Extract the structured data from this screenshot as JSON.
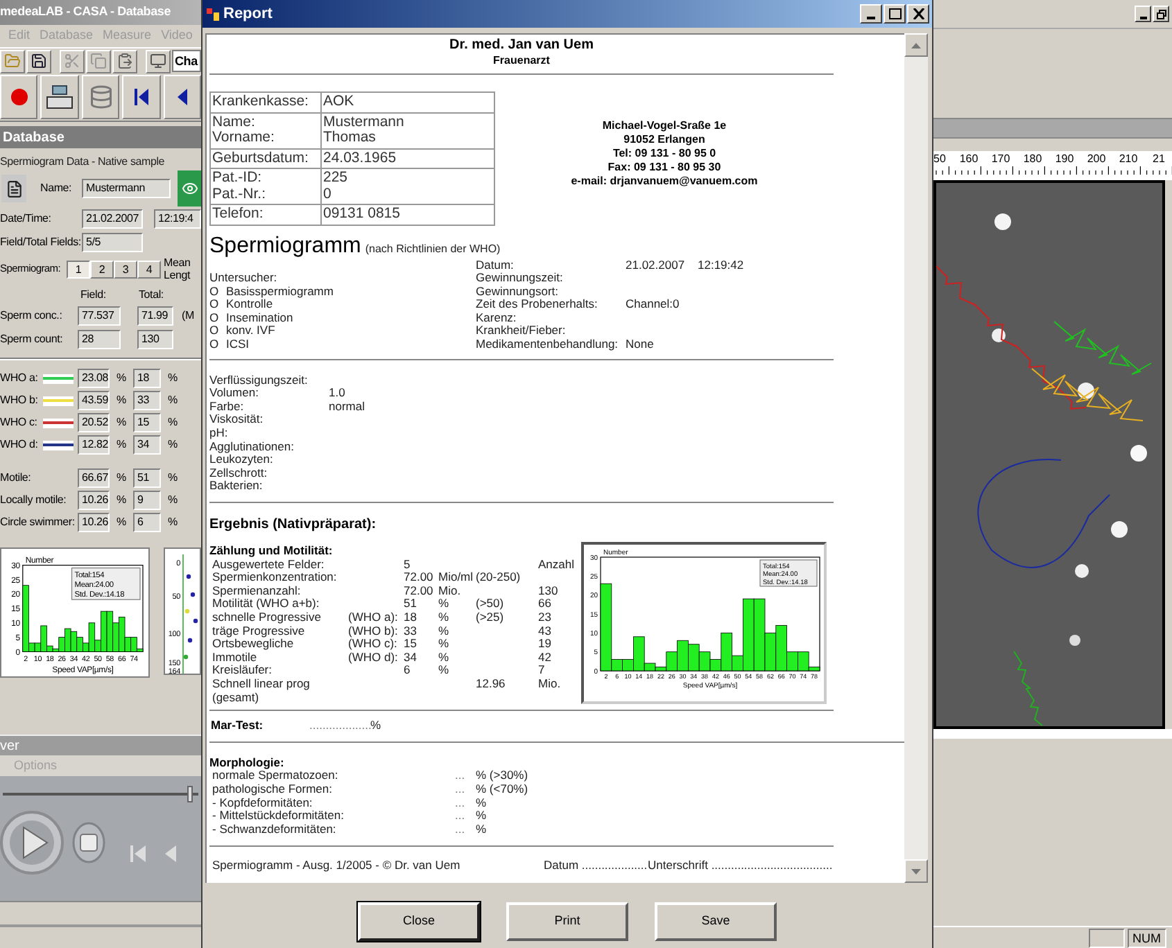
{
  "app": {
    "title": "medeaLAB - CASA - Database",
    "menu": [
      "Edit",
      "Database",
      "Measure",
      "Video"
    ],
    "combo_value": "Cha",
    "panel_title": "Database",
    "group_title": "Spermiogram Data - Native sample",
    "name_label": "Name:",
    "name_value": "Mustermann",
    "datetime_label": "Date/Time:",
    "date_value": "21.02.2007",
    "time_value": "12:19:4",
    "fields_label": "Field/Total Fields:",
    "fields_value": "5/5",
    "spermiogram_label": "Spermiogram:",
    "spermiogram_tabs": [
      {
        "label": "1",
        "selected": true
      },
      {
        "label": "2",
        "selected": false
      },
      {
        "label": "3",
        "selected": false
      },
      {
        "label": "4",
        "selected": false
      }
    ],
    "mean_label": "Mean",
    "length_label": "Lengt",
    "field_header": "Field:",
    "total_header": "Total:",
    "measures": [
      {
        "label": "Sperm conc.:",
        "field": "77.537",
        "total": "71.99",
        "unit": "(M"
      },
      {
        "label": "Sperm count:",
        "field": "28",
        "total": "130"
      }
    ],
    "who": [
      {
        "label": "WHO a:",
        "color": "#33cc55",
        "field": "23.08",
        "field_unit": "%",
        "total": "18",
        "total_unit": "%"
      },
      {
        "label": "WHO b:",
        "color": "#eedd44",
        "field": "43.59",
        "field_unit": "%",
        "total": "33",
        "total_unit": "%"
      },
      {
        "label": "WHO c:",
        "color": "#cc3333",
        "field": "20.52",
        "field_unit": "%",
        "total": "15",
        "total_unit": "%"
      },
      {
        "label": "WHO d:",
        "color": "#223388",
        "field": "12.82",
        "field_unit": "%",
        "total": "34",
        "total_unit": "%"
      }
    ],
    "motility": [
      {
        "label": "Motile:",
        "field": "66.67",
        "field_unit": "%",
        "total": "51",
        "total_unit": "%"
      },
      {
        "label": "Locally motile:",
        "field": "10.26",
        "field_unit": "%",
        "total": "9",
        "total_unit": "%"
      },
      {
        "label": "Circle swimmer:",
        "field": "10.26",
        "field_unit": "%",
        "total": "6",
        "total_unit": "%"
      }
    ],
    "chart_data": {
      "type": "bar",
      "xlabel": "Speed VAP[µm/s]",
      "xlim": [
        0,
        80
      ],
      "x": [
        2,
        6,
        10,
        14,
        18,
        22,
        26,
        30,
        34,
        38,
        42,
        46,
        50,
        54,
        58,
        62,
        66,
        70,
        74,
        78
      ],
      "xticks": [
        2,
        10,
        18,
        26,
        34,
        42,
        50,
        58,
        66,
        74
      ],
      "yticks": [
        0,
        5,
        10,
        15,
        20,
        25,
        30
      ],
      "ylim": [
        0,
        30
      ],
      "series": [
        {
          "name": "Number",
          "color": "#22ee22",
          "values": [
            23,
            3,
            3,
            9,
            2,
            1,
            5,
            8,
            7,
            5,
            3,
            10,
            4,
            14,
            14,
            10,
            12,
            5,
            5,
            1
          ]
        }
      ],
      "annotations": [
        "Total:154",
        "Mean:24.00",
        "Std. Dev.:14.18"
      ]
    },
    "scatter_ticks": [
      "0",
      "50",
      "100",
      "150",
      "164"
    ]
  },
  "player": {
    "title": "ver",
    "menu": "Options",
    "level": 0.97
  },
  "report": {
    "title": "Report",
    "doctor": "Dr. med. Jan van Uem",
    "specialty": "Frauenarzt",
    "patient_table": [
      {
        "labels": [
          "Krankenkasse:"
        ],
        "values": [
          "AOK"
        ]
      },
      {
        "labels": [
          "Name:",
          "Vorname:"
        ],
        "values": [
          "Mustermann",
          "Thomas"
        ]
      },
      {
        "labels": [
          "Geburtsdatum:"
        ],
        "values": [
          "24.03.1965"
        ]
      },
      {
        "labels": [
          "Pat.-ID:",
          "Pat.-Nr.:"
        ],
        "values": [
          "225",
          "0"
        ]
      },
      {
        "labels": [
          "Telefon:"
        ],
        "values": [
          "09131 0815"
        ]
      }
    ],
    "address": [
      "Michael-Vogel-Sraße 1e",
      "91052 Erlangen",
      "Tel: 09 131 - 80 95 0",
      "Fax: 09 131 - 80 95 30",
      "e-mail: drjanvanuem@vanuem.com"
    ],
    "heading": "Spermiogramm",
    "heading_note": "(nach Richtlinien der WHO)",
    "examiner_label": "Untersucher:",
    "options": [
      {
        "mark": "O",
        "label": "Basisspermiogramm"
      },
      {
        "mark": "O",
        "label": "Kontrolle"
      },
      {
        "mark": "O",
        "label": "Insemination"
      },
      {
        "mark": "O",
        "label": "konv. IVF"
      },
      {
        "mark": "O",
        "label": "ICSI"
      }
    ],
    "sample_info": [
      {
        "label": "Datum:",
        "value": "21.02.2007",
        "value_2": "12:19:42"
      },
      {
        "label": "Gewinnungszeit:"
      },
      {
        "label": "Gewinnungsort:"
      },
      {
        "label": "Zeit des Probenerhalts:",
        "value": "Channel:0"
      },
      {
        "label": "Karenz:"
      },
      {
        "label": "Krankheit/Fieber:"
      },
      {
        "label": "Medikamentenbehandlung:",
        "value": "None"
      }
    ],
    "physical": [
      {
        "label": "Verflüssigungszeit:"
      },
      {
        "label": "Volumen:",
        "value": "1.0"
      },
      {
        "label": "Farbe:",
        "value": "normal"
      },
      {
        "label": "Viskosität:"
      },
      {
        "label": "pH:"
      },
      {
        "label": "Agglutinationen:"
      },
      {
        "label": "Leukozyten:"
      },
      {
        "label": "Zellschrott:"
      },
      {
        "label": "Bakterien:"
      }
    ],
    "result_heading": "Ergebnis (Nativpräparat):",
    "count_heading": "Zählung und Motilität:",
    "count_rows": [
      {
        "label": "Ausgewertete Felder:",
        "value": "5",
        "column_6": "Anzahl"
      },
      {
        "label": "Spermienkonzentration:",
        "value": "72.00",
        "unit": "Mio/ml",
        "column_5": "(20-250)"
      },
      {
        "label": "Spermienanzahl:",
        "value": "72.00",
        "unit": "Mio.",
        "column_6": "130"
      },
      {
        "label": "Motilität (WHO a+b):",
        "value": "51",
        "unit": "%",
        "column_5": "(>50)",
        "column_6": "66"
      },
      {
        "label": "schnelle Progressive",
        "who": "(WHO a):",
        "value": "18",
        "unit": "%",
        "column_5": "(>25)",
        "column_6": "23"
      },
      {
        "label": "träge Progressive",
        "who": "(WHO b):",
        "value": "33",
        "unit": "%",
        "column_6": "43"
      },
      {
        "label": "Ortsbewegliche",
        "who": "(WHO c):",
        "value": "15",
        "unit": "%",
        "column_6": "19"
      },
      {
        "label": "Immotile",
        "who": "(WHO d):",
        "value": "34",
        "unit": "%",
        "column_6": "42"
      },
      {
        "label": "Kreisläufer:",
        "value": "6",
        "unit": "%",
        "column_6": "7"
      },
      {
        "label": "Schnell linear prog (gesamt)",
        "column_5": "12.96",
        "column_6": "Mio."
      }
    ],
    "chart_data": {
      "type": "bar",
      "xlabel": "Speed VAP[µm/s]",
      "xlim": [
        0,
        80
      ],
      "x": [
        2,
        6,
        10,
        14,
        18,
        22,
        26,
        30,
        34,
        38,
        42,
        46,
        50,
        54,
        58,
        62,
        66,
        70,
        74,
        78
      ],
      "xticks": [
        2,
        6,
        10,
        14,
        18,
        22,
        26,
        30,
        34,
        38,
        42,
        46,
        50,
        54,
        58,
        62,
        66,
        70,
        74,
        78
      ],
      "yticks": [
        0,
        5,
        10,
        15,
        20,
        25,
        30
      ],
      "ylim": [
        0,
        30
      ],
      "series": [
        {
          "name": "Number",
          "color": "#22ee22",
          "values": [
            23,
            3,
            3,
            9,
            2,
            1,
            5,
            8,
            7,
            5,
            3,
            10,
            4,
            19,
            19,
            10,
            12,
            5,
            5,
            1
          ]
        }
      ],
      "annotations": [
        "Total:154",
        "Mean:24.00",
        "Std. Dev.:14.18"
      ]
    },
    "mar_test": {
      "label": "Mar-Test:",
      "blank": "...................",
      "unit": "%"
    },
    "morphology_heading": "Morphologie:",
    "morphology": [
      {
        "label": "normale Spermatozoen:",
        "value": "...",
        "unit": "% (>30%)"
      },
      {
        "label": "pathologische Formen:",
        "value": "...",
        "unit": "% (<70%)"
      },
      {
        "label": "- Kopfdeformitäten:",
        "value": "...",
        "unit": "%"
      },
      {
        "label": "- Mittelstückdeformitäten:",
        "value": "...",
        "unit": "%"
      },
      {
        "label": "- Schwanzdeformitäten:",
        "value": "...",
        "unit": "%"
      }
    ],
    "footer": {
      "edition": "Spermiogramm - Ausg. 1/2005 - © Dr. van Uem",
      "date": "Datum ....................",
      "signature": "Unterschrift ....................................."
    },
    "buttons": [
      "Close",
      "Print",
      "Save"
    ]
  },
  "viewer": {
    "ruler_labels": [
      "50",
      "160",
      "170",
      "180",
      "190",
      "200",
      "210",
      "21"
    ]
  },
  "status_bar": {
    "num": "NUM"
  }
}
